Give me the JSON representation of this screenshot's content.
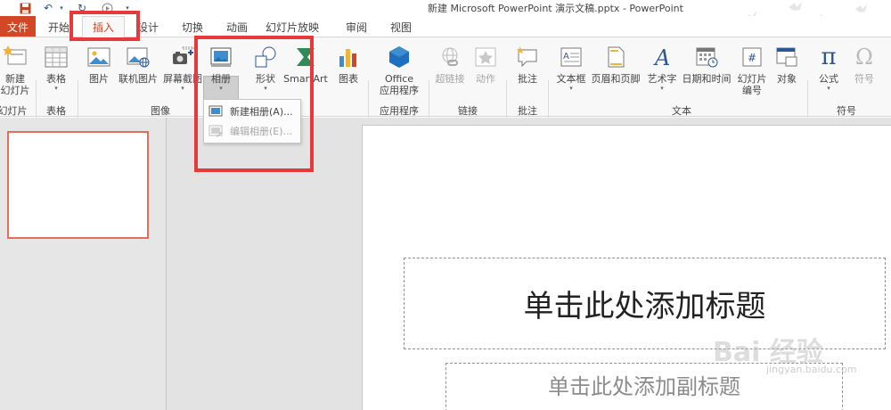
{
  "window_title": "新建 Microsoft PowerPoint 演示文稿.pptx - PowerPoint",
  "tabs": {
    "file": "文件",
    "home": "开始",
    "insert": "插入",
    "design": "设计",
    "transitions": "切换",
    "animations": "动画",
    "slideshow": "幻灯片放映",
    "review": "审阅",
    "view": "视图"
  },
  "ribbon": {
    "new_slide_line1": "新建",
    "new_slide_line2": "幻灯片",
    "table": "表格",
    "picture": "图片",
    "online_picture": "联机图片",
    "screenshot": "屏幕截图",
    "photo_album": "相册",
    "shapes": "形状",
    "smartart": "SmartArt",
    "chart": "图表",
    "office_apps_line1": "Office",
    "office_apps_line2": "应用程序",
    "hyperlink": "超链接",
    "action": "动作",
    "comment": "批注",
    "textbox": "文本框",
    "header_footer": "页眉和页脚",
    "wordart": "艺术字",
    "date_time": "日期和时间",
    "slide_number_line1": "幻灯片",
    "slide_number_line2": "编号",
    "object": "对象",
    "equation": "公式",
    "symbol": "符号"
  },
  "groups": {
    "slides": "幻灯片",
    "tables": "表格",
    "images": "图像",
    "apps": "应用程序",
    "links": "链接",
    "comments": "批注",
    "text": "文本",
    "symbols": "符号"
  },
  "album_menu": {
    "new_album": "新建相册(A)...",
    "edit_album": "编辑相册(E)..."
  },
  "slide": {
    "title_placeholder": "单击此处添加标题",
    "subtitle_placeholder": "单击此处添加副标题"
  },
  "watermark": {
    "text": "Bai 经验",
    "sub": "jingyan.baidu.com"
  },
  "colors": {
    "accent": "#d24726",
    "annotation_red": "#e8393a",
    "ribbon_bg": "#f8f8f8"
  }
}
